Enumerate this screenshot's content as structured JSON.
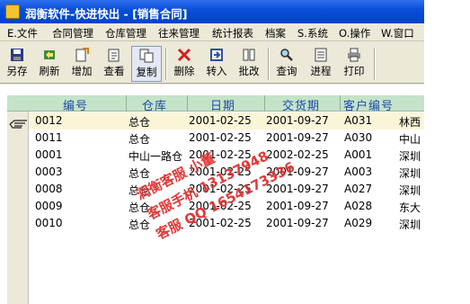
{
  "window": {
    "title": "润衡软件-快进快出 - [销售合同]"
  },
  "menu": [
    {
      "label": "E.文件"
    },
    {
      "label": "合同管理"
    },
    {
      "label": "仓库管理"
    },
    {
      "label": "往来管理"
    },
    {
      "label": "统计报表"
    },
    {
      "label": "档案"
    },
    {
      "label": "S.系统"
    },
    {
      "label": "O.操作"
    },
    {
      "label": "W.窗口"
    }
  ],
  "toolbar": [
    {
      "label": "另存",
      "icon": "save-as-icon"
    },
    {
      "label": "刷新",
      "icon": "refresh-icon"
    },
    {
      "label": "增加",
      "icon": "add-icon"
    },
    {
      "label": "查看",
      "icon": "view-icon"
    },
    {
      "label": "复制",
      "icon": "copy-icon"
    },
    {
      "label": "删除",
      "icon": "delete-icon"
    },
    {
      "label": "转入",
      "icon": "transfer-in-icon"
    },
    {
      "label": "批改",
      "icon": "batch-edit-icon"
    },
    {
      "label": "查询",
      "icon": "query-icon"
    },
    {
      "label": "进程",
      "icon": "process-icon"
    },
    {
      "label": "打印",
      "icon": "print-icon"
    }
  ],
  "grid": {
    "columns": [
      "编号",
      "仓库",
      "日期",
      "交货期",
      "客户编号"
    ],
    "rows": [
      {
        "id": "0012",
        "warehouse": "总仓",
        "date": "2001-02-25",
        "delivery": "2001-09-27",
        "customer": "A031",
        "extra": "林西"
      },
      {
        "id": "0011",
        "warehouse": "总仓",
        "date": "2001-02-25",
        "delivery": "2001-09-27",
        "customer": "A030",
        "extra": "中山"
      },
      {
        "id": "0001",
        "warehouse": "中山一路仓",
        "date": "2001-02-25",
        "delivery": "2002-02-25",
        "customer": "A001",
        "extra": "深圳"
      },
      {
        "id": "0003",
        "warehouse": "总仓",
        "date": "2001-02-25",
        "delivery": "2001-09-27",
        "customer": "A003",
        "extra": "深圳"
      },
      {
        "id": "0008",
        "warehouse": "总仓",
        "date": "2001-02-25",
        "delivery": "2001-09-27",
        "customer": "A027",
        "extra": "深圳"
      },
      {
        "id": "0009",
        "warehouse": "总仓",
        "date": "2001-02-25",
        "delivery": "2001-09-27",
        "customer": "A028",
        "extra": "东大"
      },
      {
        "id": "0010",
        "warehouse": "总仓",
        "date": "2001-02-25",
        "delivery": "2001-09-27",
        "customer": "A029",
        "extra": "深圳"
      }
    ]
  },
  "watermark": {
    "line1": "润衡客服 小董",
    "line2": "客服手机 13137948",
    "line3": "客服 QQ 1654173336"
  }
}
